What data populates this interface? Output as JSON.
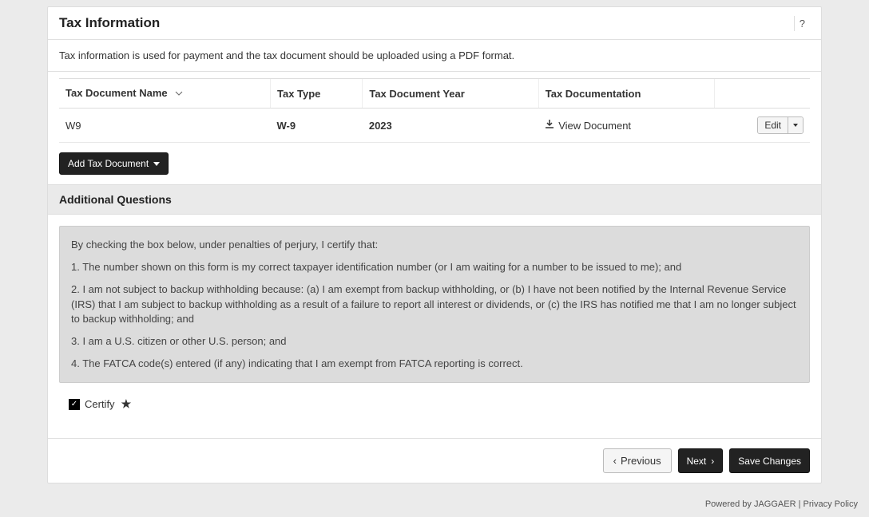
{
  "header": {
    "title": "Tax Information",
    "help": "?"
  },
  "info": "Tax information is used for payment and the tax document should be uploaded using a PDF format.",
  "table": {
    "columns": {
      "name": "Tax Document Name",
      "type": "Tax Type",
      "year": "Tax Document Year",
      "documentation": "Tax Documentation"
    },
    "row": {
      "name": "W9",
      "type": "W-9",
      "year": "2023",
      "view": "View Document",
      "edit": "Edit"
    }
  },
  "addButton": "Add Tax Document",
  "additional": {
    "title": "Additional Questions",
    "intro": "By checking the box below, under penalties of perjury, I certify that:",
    "p1": "1. The number shown on this form is my correct taxpayer identification number (or I am waiting for a number to be issued to me); and",
    "p2": "2. I am not subject to backup withholding because: (a) I am exempt from backup withholding, or (b) I have not been notified by the Internal Revenue Service (IRS) that I am subject to backup withholding as a result of a failure to report all interest or dividends, or (c) the IRS has notified me that I am no longer subject to backup withholding; and",
    "p3": "3. I am a U.S. citizen or other U.S. person; and",
    "p4": "4. The FATCA code(s) entered (if any) indicating that I am exempt from FATCA reporting is correct."
  },
  "certify": {
    "label": "Certify",
    "star": "★"
  },
  "footer": {
    "previous": "Previous",
    "next": "Next",
    "save": "Save Changes"
  },
  "pageFooter": {
    "poweredBy": "Powered by",
    "brand": "JAGGAER",
    "sep": " | ",
    "privacy": "Privacy Policy"
  }
}
